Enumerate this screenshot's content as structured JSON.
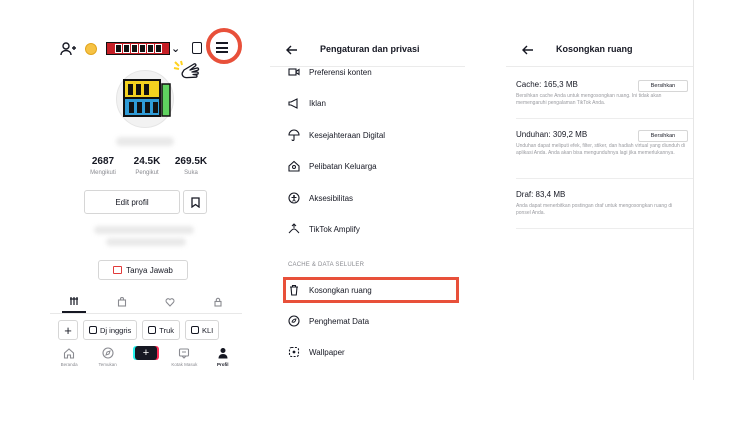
{
  "profile": {
    "stats": [
      {
        "value": "2687",
        "label": "Mengikuti"
      },
      {
        "value": "24.5K",
        "label": "Pengikut"
      },
      {
        "value": "269.5K",
        "label": "Suka"
      }
    ],
    "edit_label": "Edit profil",
    "qa_label": "Tanya Jawab",
    "chips": [
      "Dj inggris",
      "Truk",
      "KLI"
    ],
    "nav": [
      {
        "label": "Beranda",
        "icon": "home-icon"
      },
      {
        "label": "Temukan",
        "icon": "compass-icon"
      },
      {
        "label": "",
        "icon": "create-icon"
      },
      {
        "label": "Kotak Masuk",
        "icon": "inbox-icon"
      },
      {
        "label": "Profil",
        "icon": "profile-icon"
      }
    ]
  },
  "settings": {
    "title": "Pengaturan dan privasi",
    "items": [
      {
        "label": "Preferensi konten",
        "icon": "video-icon"
      },
      {
        "label": "Iklan",
        "icon": "megaphone-icon"
      },
      {
        "label": "Kesejahteraan Digital",
        "icon": "umbrella-icon"
      },
      {
        "label": "Pelibatan Keluarga",
        "icon": "family-home-icon"
      },
      {
        "label": "Aksesibilitas",
        "icon": "accessibility-icon"
      },
      {
        "label": "TikTok Amplify",
        "icon": "amplify-icon"
      }
    ],
    "section_label": "CACHE & DATA SELULER",
    "cache_items": [
      {
        "label": "Kosongkan ruang",
        "icon": "trash-icon"
      },
      {
        "label": "Penghemat Data",
        "icon": "data-saver-icon"
      },
      {
        "label": "Wallpaper",
        "icon": "wallpaper-icon"
      }
    ]
  },
  "clear_space": {
    "title": "Kosongkan ruang",
    "rows": [
      {
        "title": "Cache: 165,3 MB",
        "desc": "Bersihkan cache Anda untuk mengosongkan ruang. Ini tidak akan memengaruhi pengalaman TikTok Anda.",
        "button": "Bersihkan"
      },
      {
        "title": "Unduhan: 309,2 MB",
        "desc": "Unduhan dapat meliputi efek, filter, stiker, dan hadiah virtual yang diunduh di aplikasi Anda. Anda akan bisa mengunduhnya lagi jika memerlukannya.",
        "button": "Bersihkan"
      },
      {
        "title": "Draf: 83,4 MB",
        "desc": "Anda dapat menerbitkan postingan draf untuk mengosongkan ruang di ponsel Anda."
      }
    ]
  },
  "colors": {
    "accent_red": "#e8503a",
    "text_primary": "#161823",
    "text_secondary": "#8a8b91"
  }
}
